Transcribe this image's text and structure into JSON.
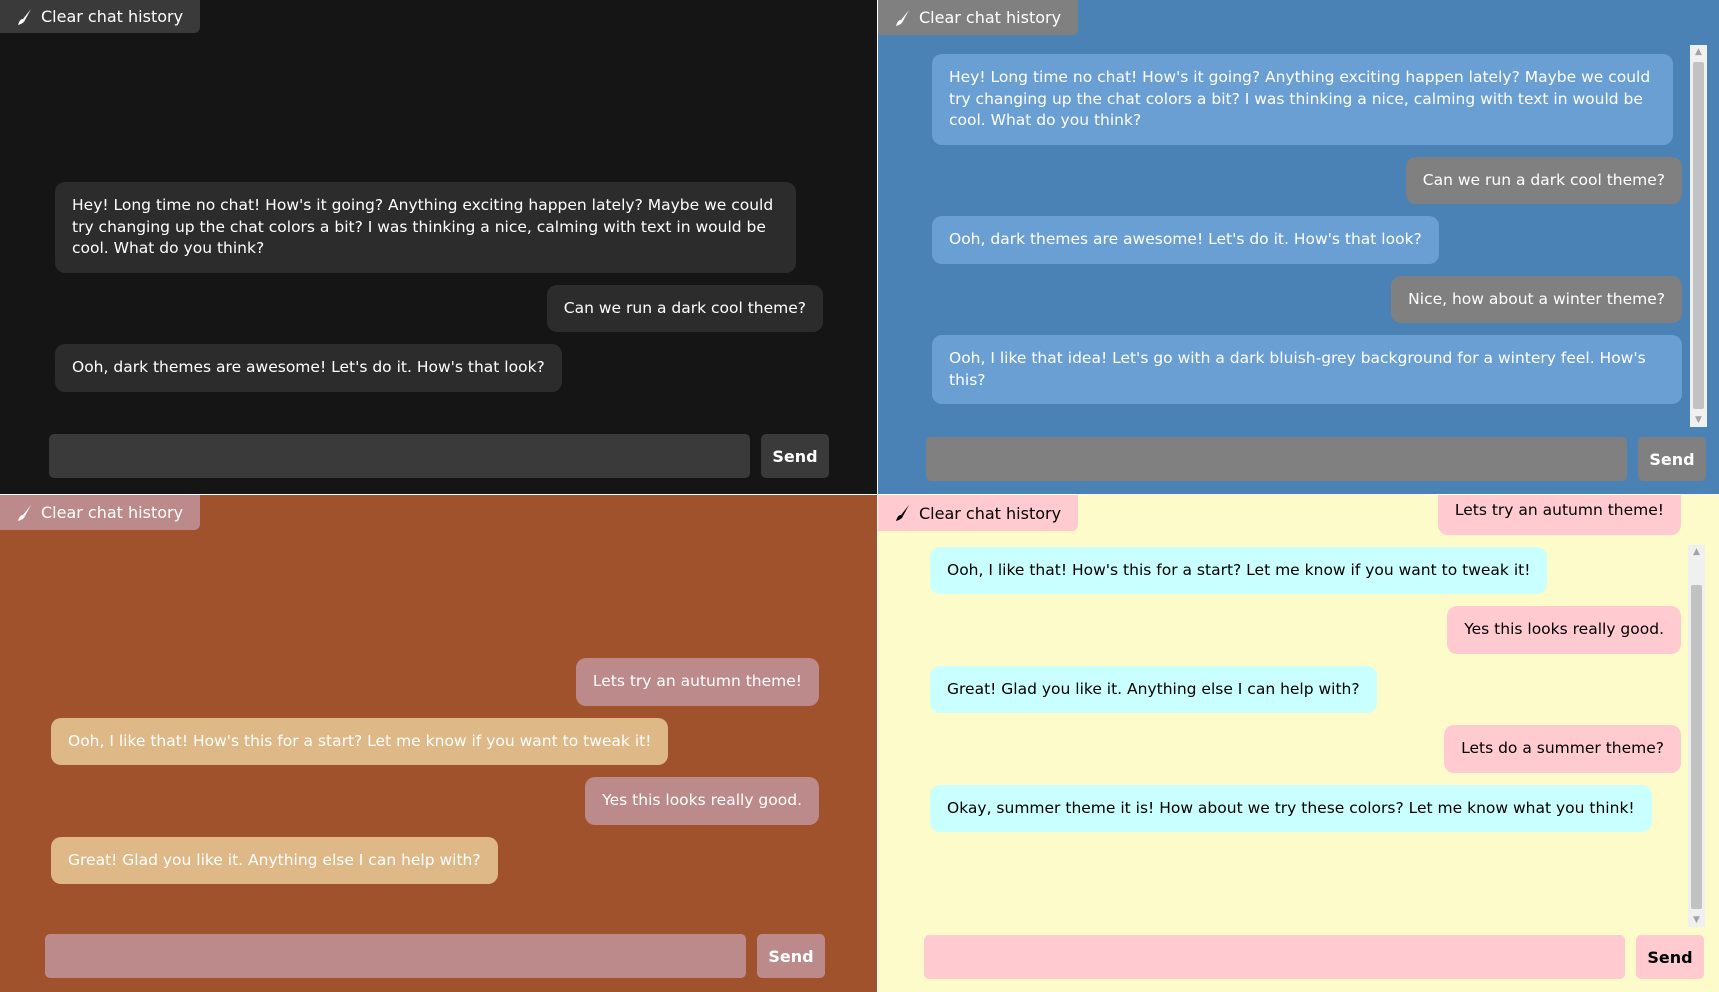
{
  "panels": {
    "dark": {
      "clear_label": "Clear chat history",
      "send_label": "Send",
      "input_value": "",
      "messages": [
        {
          "role": "bot",
          "text": "Hey! Long time no chat! How's it going? Anything exciting happen lately? Maybe we could try changing up the chat colors a bit? I was thinking a nice, calming with text in would be cool. What do you think?"
        },
        {
          "role": "user",
          "text": "Can we run a dark cool theme?"
        },
        {
          "role": "bot",
          "text": "Ooh, dark themes are awesome! Let's do it. How's that look?"
        }
      ]
    },
    "blue": {
      "clear_label": "Clear chat history",
      "send_label": "Send",
      "input_value": "",
      "messages": [
        {
          "role": "bot",
          "text": "Hey! Long time no chat! How's it going? Anything exciting happen lately? Maybe we could try changing up the chat colors a bit? I was thinking a nice, calming with text in would be cool. What do you think?"
        },
        {
          "role": "user",
          "text": "Can we run a dark cool theme?"
        },
        {
          "role": "bot",
          "text": "Ooh, dark themes are awesome! Let's do it. How's that look?"
        },
        {
          "role": "user",
          "text": "Nice, how about a winter theme?"
        },
        {
          "role": "bot",
          "text": "Ooh, I like that idea! Let's go with a dark bluish-grey background for a wintery feel. How's this?"
        }
      ]
    },
    "autumn": {
      "clear_label": "Clear chat history",
      "send_label": "Send",
      "input_value": "",
      "messages": [
        {
          "role": "user",
          "text": "Lets try an autumn theme!"
        },
        {
          "role": "bot",
          "text": "Ooh, I like that!  How's this for a start? Let me know if you want to tweak it!"
        },
        {
          "role": "user",
          "text": "Yes this looks really good."
        },
        {
          "role": "bot",
          "text": "Great!  Glad you like it.  Anything else I can help with?"
        }
      ]
    },
    "summer": {
      "clear_label": "Clear chat history",
      "send_label": "Send",
      "input_value": "",
      "messages": [
        {
          "role": "user",
          "text": "Lets try an autumn theme!"
        },
        {
          "role": "bot",
          "text": "Ooh, I like that!  How's this for a start? Let me know if you want to tweak it!"
        },
        {
          "role": "user",
          "text": "Yes this looks really good."
        },
        {
          "role": "bot",
          "text": "Great!  Glad you like it.  Anything else I can help with?"
        },
        {
          "role": "user",
          "text": "Lets do a summer theme?"
        },
        {
          "role": "bot",
          "text": "Okay, summer theme it is! How about we try these colors? Let me know what you think!"
        }
      ]
    }
  },
  "icons": {
    "clear": "brush-icon",
    "scroll_up": "scroll-up-arrow-icon",
    "scroll_down": "scroll-down-arrow-icon"
  },
  "colors": {
    "dark_bg": "#151515",
    "dark_bubble": "#2c2c2c",
    "blue_bg": "#4a82b5",
    "blue_bot": "#6a9fd4",
    "blue_user": "#808080",
    "autumn_bg": "#a0522d",
    "autumn_bot": "#deb887",
    "autumn_user": "#bc8a8a",
    "summer_bg": "#fefbca",
    "summer_bot": "#caffff",
    "summer_user": "#ffcbd1"
  }
}
